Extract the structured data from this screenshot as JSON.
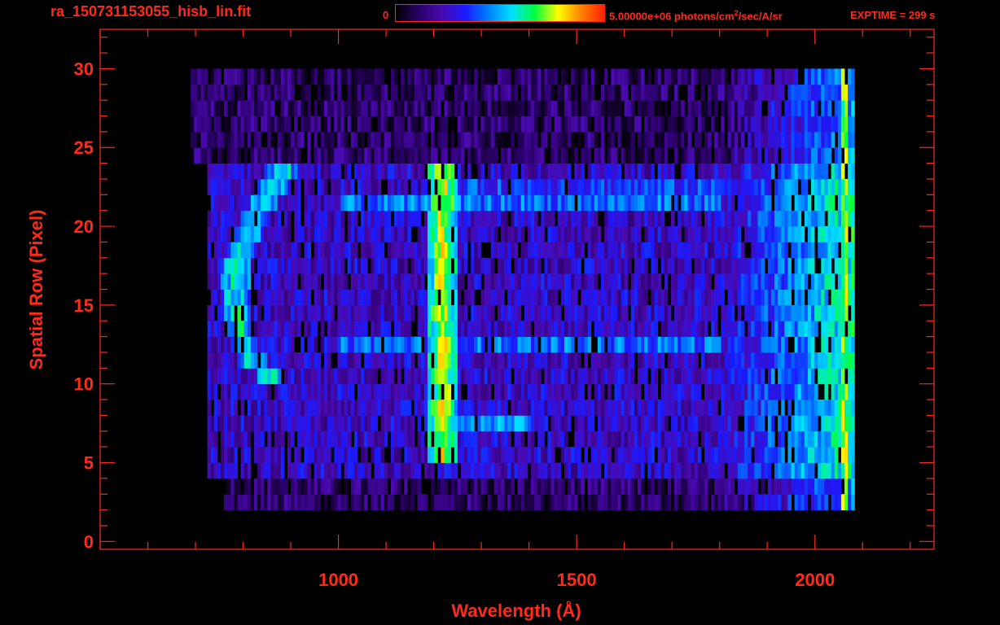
{
  "header": {
    "title": "ra_150731153055_hisb_lin.fit",
    "colorbar_min_label": "0",
    "colorbar_max_label_pre": "5.00000e+06 photons/cm",
    "colorbar_max_label_sup": "2",
    "colorbar_max_label_post": "/sec/A/sr",
    "exptime_label": "EXPTIME = 299 s"
  },
  "colors": {
    "axis": "#ff2a1a",
    "background": "#000000",
    "colormap": [
      "#000000",
      "#2a0068",
      "#4a0ab0",
      "#1a1aff",
      "#0080ff",
      "#00e0ff",
      "#00ff40",
      "#ffff00",
      "#ff8000",
      "#ff2000"
    ]
  },
  "chart_data": {
    "type": "heatmap",
    "xlabel": "Wavelength (Å)",
    "ylabel": "Spatial Row (Pixel)",
    "xlim": [
      500,
      2250
    ],
    "ylim": [
      -0.5,
      32.5
    ],
    "x_ticks": [
      1000,
      1500,
      2000
    ],
    "y_ticks": [
      0,
      5,
      10,
      15,
      20,
      25,
      30
    ],
    "x_tick_labels": [
      "1000",
      "1500",
      "2000"
    ],
    "y_tick_labels": [
      "0",
      "5",
      "10",
      "15",
      "20",
      "25",
      "30"
    ],
    "x_minor_step": 100,
    "y_minor_step": 1,
    "colorbar_range": [
      0,
      5000000
    ],
    "colorbar_unit": "photons/cm^2/sec/A/sr",
    "grid": false,
    "data_extent": {
      "wavelength": [
        690,
        2090
      ],
      "rows": [
        0,
        30
      ]
    },
    "features": {
      "bright_line": {
        "wavelength": 1216,
        "rows": [
          5,
          24
        ],
        "level": 0.78
      },
      "bright_streak": {
        "row_wavelengths": [
          [
            10,
            855
          ],
          [
            11,
            815
          ],
          [
            12,
            800
          ],
          [
            13,
            790
          ],
          [
            14,
            785
          ],
          [
            15,
            780
          ],
          [
            16,
            780
          ],
          [
            17,
            782
          ],
          [
            18,
            790
          ],
          [
            19,
            805
          ],
          [
            20,
            820
          ],
          [
            21,
            840
          ],
          [
            22,
            860
          ],
          [
            23,
            880
          ]
        ],
        "level": 0.6
      },
      "red_edge": {
        "wavelength": 2060,
        "rows": [
          2,
          30
        ],
        "level": 0.7
      },
      "background_rows": [
        {
          "rows": [
            4,
            24
          ],
          "wavelengths": [
            720,
            2080
          ],
          "level": 0.25
        },
        {
          "rows": [
            24,
            30
          ],
          "wavelengths": [
            690,
            2080
          ],
          "level": 0.12
        },
        {
          "rows": [
            2,
            4
          ],
          "wavelengths": [
            760,
            2080
          ],
          "level": 0.12
        }
      ],
      "bright_bands": [
        {
          "row": 7,
          "wavelengths": [
            1230,
            1400
          ],
          "level": 0.5
        },
        {
          "row": 12,
          "wavelengths": [
            1000,
            1800
          ],
          "level": 0.42
        },
        {
          "row": 21,
          "wavelengths": [
            1000,
            1800
          ],
          "level": 0.42
        },
        {
          "row": 22,
          "wavelengths": [
            1250,
            1850
          ],
          "level": 0.36
        }
      ]
    }
  }
}
